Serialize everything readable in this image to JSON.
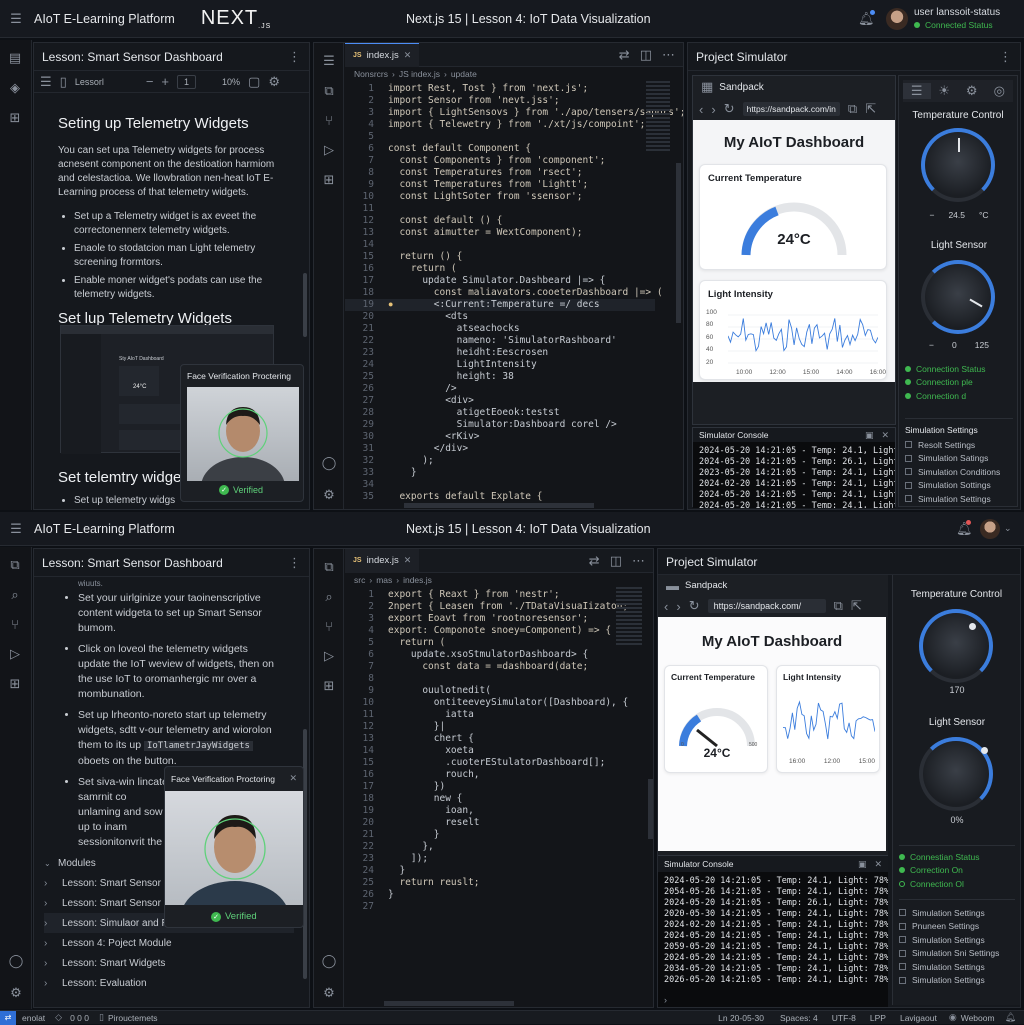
{
  "top": {
    "app_title": "AIoT E-Learning Platform",
    "logo_text": "NEXT",
    "logo_suffix": ".JS",
    "center_title": "Next.js 15 | Lesson 4: IoT Data Visualization",
    "user_name": "user lanssoit-status",
    "user_status": "Connected Status"
  },
  "lesson1": {
    "panel_title": "Lesson: Smart Sensor Dashboard",
    "toolbar_label": "Lessorl",
    "page_value": "1",
    "zoom": "10%",
    "heading1": "Seting up Telemetry Widgets",
    "para": "You can set upa Telemetry widgets for process acnesent component on the destioation harmiom and celestactioa. We llowbration nen-heat IoT E-Learning process of that telemetry widgets.",
    "bullets": [
      "Set up a Telemetry widget is ax eveet the correctonennerx telemetry widgets.",
      "Enaole to stodatcion man Light telemetry screening frormtors.",
      "Enable moner widget's podats can use the telemetry widgets."
    ],
    "heading2": "Set lup Telemetry Widgets",
    "heading3": "Set telemtry widgets",
    "bullet_last": "Set up telemetry widgs",
    "thumb_title": "Sty AIoT Dashboard",
    "thumb_temp": "24°C"
  },
  "face1": {
    "title": "Face Verification Proctering",
    "verified": "Verified"
  },
  "editor1": {
    "tab": "index.js",
    "breadcrumb": [
      "Nonsrcrs",
      "JS index.js",
      "update"
    ],
    "lines": [
      {
        "n": "1",
        "t": "import Rest, Tost } from 'next.js';"
      },
      {
        "n": "2",
        "t": "import Sensor from 'nevt.jss';"
      },
      {
        "n": "3",
        "t": "import { LightSensovs } from './apo/tensers/sapors';"
      },
      {
        "n": "4",
        "t": "import { Telewetry } from './xt/js/compoint';"
      },
      {
        "n": "5",
        "t": ""
      },
      {
        "n": "6",
        "t": "const default Component {"
      },
      {
        "n": "7",
        "t": "  const Components } from 'component';"
      },
      {
        "n": "8",
        "t": "  const Temperatures from 'rsect';"
      },
      {
        "n": "9",
        "t": "  const Temperatures from 'Lightt';"
      },
      {
        "n": "10",
        "t": "  const LightSoter from 'ssensor';"
      },
      {
        "n": "11",
        "t": ""
      },
      {
        "n": "12",
        "t": "  const default () {"
      },
      {
        "n": "13",
        "t": "  const aimutter = WextComponent);"
      },
      {
        "n": "14",
        "t": ""
      },
      {
        "n": "15",
        "t": "  return () {"
      },
      {
        "n": "16",
        "t": "    return ("
      },
      {
        "n": "17",
        "t": "      update Simulator.Dashbeard |=> {"
      },
      {
        "n": "18",
        "t": "        const maliavators.cooeterDashboard |=> ("
      },
      {
        "n": "19",
        "t": "        <:Current:Temperature =/ decs"
      },
      {
        "n": "20",
        "t": "          <dts"
      },
      {
        "n": "21",
        "t": "            atseachocks"
      },
      {
        "n": "22",
        "t": "            nameno: 'SimulatorRashboard'"
      },
      {
        "n": "23",
        "t": "            heidht:Eescrosen"
      },
      {
        "n": "24",
        "t": "            LightIntensity"
      },
      {
        "n": "25",
        "t": "            height: 38"
      },
      {
        "n": "26",
        "t": "          />"
      },
      {
        "n": "27",
        "t": "          <div>"
      },
      {
        "n": "28",
        "t": "            atigetEoeok:testst"
      },
      {
        "n": "29",
        "t": "            Simulator:Dashboard corel />"
      },
      {
        "n": "30",
        "t": "          <rKiv>"
      },
      {
        "n": "31",
        "t": "        </div>"
      },
      {
        "n": "32",
        "t": "      );"
      },
      {
        "n": "33",
        "t": "    }"
      },
      {
        "n": "34",
        "t": ""
      },
      {
        "n": "35",
        "t": "  exports default Explate {"
      }
    ]
  },
  "sim1": {
    "panel_title": "Project Simulator",
    "sandpack": "Sandpack",
    "url": "https://sandpack.com/in",
    "dash_title": "My AIoT Dashboard",
    "temp_title": "Current Temperature",
    "temp_value": "24°C",
    "light_title": "Light Intensity",
    "y_ticks": [
      "100",
      "80",
      "60",
      "40",
      "20"
    ],
    "x_ticks": [
      "10:00",
      "12:00",
      "15:00",
      "14:00",
      "16:00"
    ],
    "console_title": "Simulator Console",
    "console_lines": [
      "2024-05-20 14:21:05 - Temp: 24.1, Light: 78%",
      "2024-05-20 14:21:05 - Temp: 26.1, Light: 78%",
      "2023-05-20 14:21:05 - Temp: 24.1, Light: 78%",
      "2024-02-20 14:21:05 - Temp: 24.1, Light: 78%",
      "2024-05-20 14:21:05 - Temp: 24.1, Light: 78%",
      "2024-05-20 14:21:05 - Temp: 24.1, Light: 78%",
      "2025-05-20 14:21:05 - Temp: 24.1, Light: 78%",
      "2024-05-20 14:21:05 - Temp: 24.1, Light: 78%"
    ],
    "temp_ctrl": "Temperature Control",
    "temp_knob_val": "24.5",
    "temp_knob_unit": "°C",
    "light_sensor": "Light Sensor",
    "light_min": "0",
    "light_max": "125",
    "statuses": [
      "Connection Status",
      "Connection ple",
      "Connection d"
    ],
    "settings_title": "Simulation Settings",
    "settings": [
      "Resolt Settings",
      "Simulation Satings",
      "Simulation Conditions",
      "Simulation Sottings",
      "Simulation Settings"
    ]
  },
  "top2": {
    "app_title": "AIoT E-Learning Platform",
    "center_title": "Next.js 15 | Lesson 4: IoT Data Visualization"
  },
  "lesson2": {
    "panel_title": "Lesson: Smart Sensor Dashboard",
    "frag": "wiuuts.",
    "bullets": [
      "Set your uirlginize your taoinenscriptive content widgeta to set up Smart Sensor bumom.",
      "Click on loveol the telemetry widgets update the IoT weview of widgets, then on the use IoT to oromanhergic mr over a mombunation.",
      "Set up lrheonto-noreto start up telemetry widgets, sdtt v-our telemetry and wiorolon them to its up",
      "Set siva-win lincate samrnit co unlaming and sow up to inam sessionitonvrit the"
    ],
    "code_chip": "IoTlametrJayWidgets",
    "after_chip": "oboets on the button.",
    "modules_title": "Modules",
    "modules": [
      "Lesson: Smart Sensor D",
      "Lesson: Smart Sensor 1",
      "Lesson: Simulaor and Ru",
      "Lesson 4: Poject Module",
      "Lesson: Smart Widgets",
      "Lesson: Evaluation"
    ]
  },
  "face2": {
    "title": "Face Verification Proctoring",
    "verified": "Verified"
  },
  "editor2": {
    "tab": "index.js",
    "breadcrumb": [
      "src",
      "mas",
      "indes.js"
    ],
    "lines": [
      {
        "n": "1",
        "t": "export { Reaxt } from 'nestr';"
      },
      {
        "n": "2",
        "t": "2npert { Leasen from './TDataVisuaIizaton;"
      },
      {
        "n": "3",
        "t": "export Eoavt from 'rootnoresensor';"
      },
      {
        "n": "4",
        "t": "export: Componote snoey=Component) => {"
      },
      {
        "n": "5",
        "t": "  return ("
      },
      {
        "n": "6",
        "t": "    update.xsoStmulatorDashboard> {"
      },
      {
        "n": "7",
        "t": "      const data = =dashboard(date;"
      },
      {
        "n": "8",
        "t": ""
      },
      {
        "n": "9",
        "t": "      ouulotnedit("
      },
      {
        "n": "10",
        "t": "        ontiteeveySimulator([Dashboard), {"
      },
      {
        "n": "11",
        "t": "          iatta"
      },
      {
        "n": "12",
        "t": "        }|"
      },
      {
        "n": "13",
        "t": "        chert {"
      },
      {
        "n": "14",
        "t": "          xoeta"
      },
      {
        "n": "15",
        "t": "          .cuoterEStulatorDashboard[];"
      },
      {
        "n": "16",
        "t": "          rouch,"
      },
      {
        "n": "17",
        "t": "        })"
      },
      {
        "n": "18",
        "t": "        new {"
      },
      {
        "n": "19",
        "t": "          ioan,"
      },
      {
        "n": "20",
        "t": "          reselt"
      },
      {
        "n": "21",
        "t": "        }"
      },
      {
        "n": "22",
        "t": "      },"
      },
      {
        "n": "23",
        "t": "    ]);"
      },
      {
        "n": "24",
        "t": "  }"
      },
      {
        "n": "25",
        "t": "  return reuslt;"
      },
      {
        "n": "26",
        "t": "}"
      },
      {
        "n": "27",
        "t": ""
      }
    ]
  },
  "sim2": {
    "panel_title": "Project Simulator",
    "sandpack": "Sandpack",
    "url": "https://sandpack.com/",
    "dash_title": "My AIoT Dashboard",
    "temp_title": "Current Temperature",
    "temp_value": "24°C",
    "gauge_min": "0",
    "gauge_max": "500",
    "light_title": "Light Intensity",
    "x_ticks": [
      "16:00",
      "12:00",
      "15:00"
    ],
    "console_title": "Simulator Console",
    "console_lines": [
      "2024-05-20 14:21:05 - Temp: 24.1, Light: 78%",
      "2054-05-26 14:21:05 - Temp: 24.1, Light: 78%",
      "2024-05-20 14:21:05 - Temp: 26.1, Light: 78%",
      "2020-05-30 14:21:05 - Temp: 24.1, Light: 78%",
      "2024-02-20 14:21:05 - Temp: 24.1, Light: 78%",
      "2024-05-20 14:21:05 - Temp: 24.1, Light: 78%",
      "2059-05-20 14:21:05 - Temp: 24.1, Light: 78%",
      "2024-05-20 14:21:05 - Temp: 24.1, Light: 78%",
      "2034-05-20 14:21:05 - Temp: 24.1, Light: 78%",
      "2026-05-20 14:21:05 - Temp: 24.1, Light: 78%"
    ],
    "temp_ctrl": "Temperature Control",
    "temp_knob_val": "170",
    "light_sensor": "Light Sensor",
    "light_val": "0%",
    "statuses": [
      "Connestian Status",
      "Correction On",
      "Connection Ol"
    ],
    "settings": [
      "Simulation Settings",
      "Pnuneen Settings",
      "Simulation Settings",
      "Simulation Sni Settings",
      "Simulation Settings",
      "Simulation Settings"
    ]
  },
  "statusbar": {
    "left": [
      "enolat",
      "0 0 0",
      "Pirouctemets"
    ],
    "right": [
      "Ln 20-05-30",
      "Spaces: 4",
      "UTF-8",
      "LPP",
      "Lavigaout",
      "Weboom"
    ]
  }
}
